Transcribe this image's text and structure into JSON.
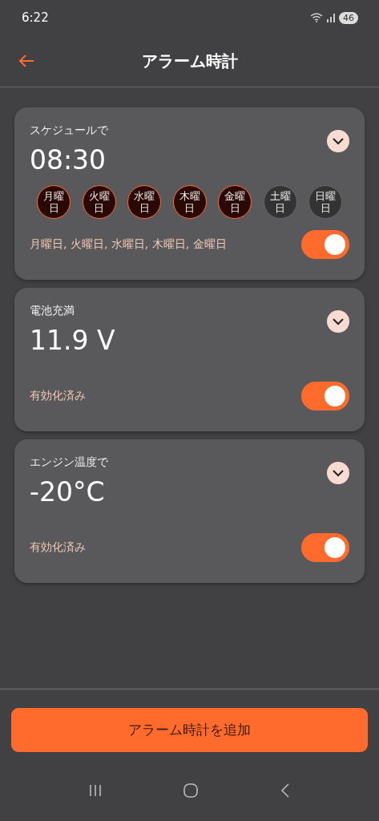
{
  "status_bar": {
    "time": "6:22",
    "battery": "46"
  },
  "header": {
    "title": "アラーム時計"
  },
  "alarms": [
    {
      "kind": "schedule",
      "label": "スケジュールで",
      "value": "08:30",
      "expanded": false,
      "on": true,
      "summary": "月曜日, 火曜日, 水曜日, 木曜日, 金曜日",
      "days": [
        {
          "label": "月曜日",
          "selected": true
        },
        {
          "label": "火曜日",
          "selected": true
        },
        {
          "label": "水曜日",
          "selected": true
        },
        {
          "label": "木曜日",
          "selected": true
        },
        {
          "label": "金曜日",
          "selected": true
        },
        {
          "label": "土曜日",
          "selected": false
        },
        {
          "label": "日曜日",
          "selected": false
        }
      ]
    },
    {
      "kind": "battery",
      "label": "電池充満",
      "value": "11.9 V",
      "expanded": false,
      "on": true,
      "summary": "有効化済み"
    },
    {
      "kind": "temperature",
      "label": "エンジン温度で",
      "value": "-20°C",
      "expanded": false,
      "on": true,
      "summary": "有効化済み"
    }
  ],
  "add_button": "アラーム時計を追加"
}
